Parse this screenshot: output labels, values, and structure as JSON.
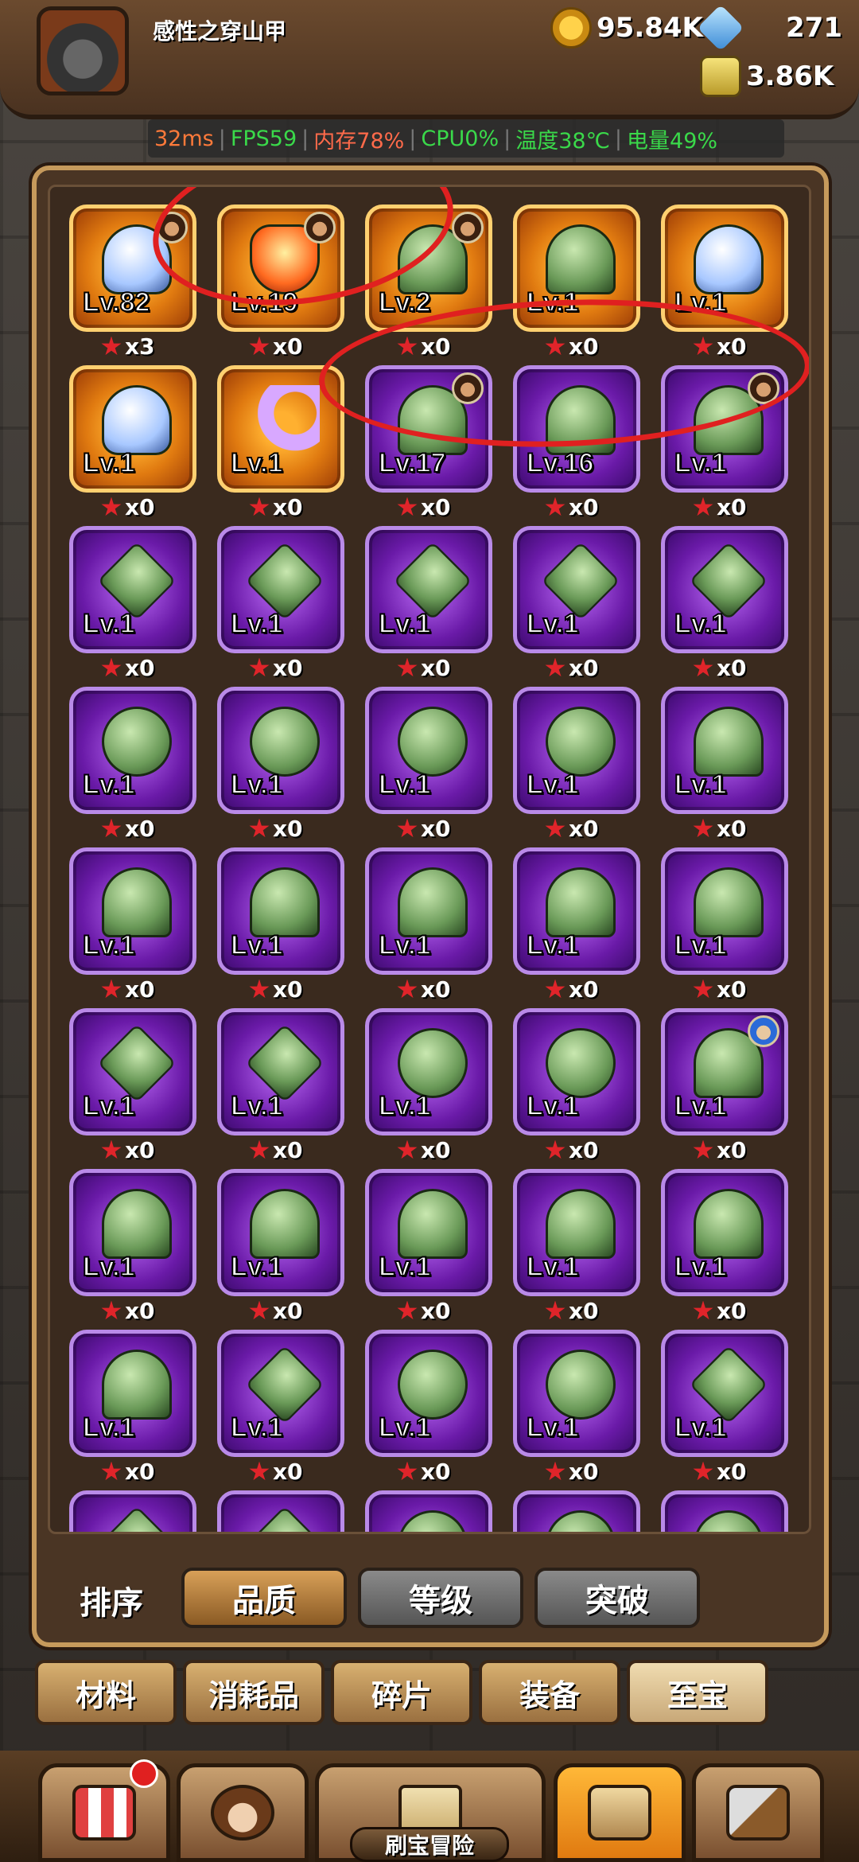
{
  "player": {
    "name": "感性之穿山甲"
  },
  "resources": {
    "gold": "95.84K",
    "gems": "271",
    "essence": "3.86K"
  },
  "perf": {
    "latency": "32ms",
    "fps": "FPS59",
    "memory": "内存78%",
    "cpu": "CPU0%",
    "temperature": "温度38℃",
    "battery": "电量49%"
  },
  "items": [
    {
      "level": "Lv.82",
      "count": "x3",
      "rarity": "orange",
      "emblem": "wing",
      "badge": "dark"
    },
    {
      "level": "Lv.19",
      "count": "x0",
      "rarity": "orange",
      "emblem": "fire",
      "badge": "dark"
    },
    {
      "level": "Lv.2",
      "count": "x0",
      "rarity": "orange",
      "emblem": "e0",
      "badge": "dark"
    },
    {
      "level": "Lv.1",
      "count": "x0",
      "rarity": "orange",
      "emblem": "e0",
      "badge": ""
    },
    {
      "level": "Lv.1",
      "count": "x0",
      "rarity": "orange",
      "emblem": "wing",
      "badge": ""
    },
    {
      "level": "Lv.1",
      "count": "x0",
      "rarity": "orange",
      "emblem": "wing",
      "badge": ""
    },
    {
      "level": "Lv.1",
      "count": "x0",
      "rarity": "orange",
      "emblem": "moon",
      "badge": ""
    },
    {
      "level": "Lv.17",
      "count": "x0",
      "rarity": "purple",
      "emblem": "e0",
      "badge": "dark"
    },
    {
      "level": "Lv.16",
      "count": "x0",
      "rarity": "purple",
      "emblem": "e0",
      "badge": ""
    },
    {
      "level": "Lv.1",
      "count": "x0",
      "rarity": "purple",
      "emblem": "e0",
      "badge": "dark"
    },
    {
      "level": "Lv.1",
      "count": "x0",
      "rarity": "purple",
      "emblem": "e2",
      "badge": ""
    },
    {
      "level": "Lv.1",
      "count": "x0",
      "rarity": "purple",
      "emblem": "e2",
      "badge": ""
    },
    {
      "level": "Lv.1",
      "count": "x0",
      "rarity": "purple",
      "emblem": "e2",
      "badge": ""
    },
    {
      "level": "Lv.1",
      "count": "x0",
      "rarity": "purple",
      "emblem": "e2",
      "badge": ""
    },
    {
      "level": "Lv.1",
      "count": "x0",
      "rarity": "purple",
      "emblem": "e2",
      "badge": ""
    },
    {
      "level": "Lv.1",
      "count": "x0",
      "rarity": "purple",
      "emblem": "e1",
      "badge": ""
    },
    {
      "level": "Lv.1",
      "count": "x0",
      "rarity": "purple",
      "emblem": "e1",
      "badge": ""
    },
    {
      "level": "Lv.1",
      "count": "x0",
      "rarity": "purple",
      "emblem": "e1",
      "badge": ""
    },
    {
      "level": "Lv.1",
      "count": "x0",
      "rarity": "purple",
      "emblem": "e1",
      "badge": ""
    },
    {
      "level": "Lv.1",
      "count": "x0",
      "rarity": "purple",
      "emblem": "e0",
      "badge": ""
    },
    {
      "level": "Lv.1",
      "count": "x0",
      "rarity": "purple",
      "emblem": "e0",
      "badge": ""
    },
    {
      "level": "Lv.1",
      "count": "x0",
      "rarity": "purple",
      "emblem": "e0",
      "badge": ""
    },
    {
      "level": "Lv.1",
      "count": "x0",
      "rarity": "purple",
      "emblem": "e0",
      "badge": ""
    },
    {
      "level": "Lv.1",
      "count": "x0",
      "rarity": "purple",
      "emblem": "e0",
      "badge": ""
    },
    {
      "level": "Lv.1",
      "count": "x0",
      "rarity": "purple",
      "emblem": "e0",
      "badge": ""
    },
    {
      "level": "Lv.1",
      "count": "x0",
      "rarity": "purple",
      "emblem": "e2",
      "badge": ""
    },
    {
      "level": "Lv.1",
      "count": "x0",
      "rarity": "purple",
      "emblem": "e2",
      "badge": ""
    },
    {
      "level": "Lv.1",
      "count": "x0",
      "rarity": "purple",
      "emblem": "e1",
      "badge": ""
    },
    {
      "level": "Lv.1",
      "count": "x0",
      "rarity": "purple",
      "emblem": "e1",
      "badge": ""
    },
    {
      "level": "Lv.1",
      "count": "x0",
      "rarity": "purple",
      "emblem": "e0",
      "badge": "blue"
    },
    {
      "level": "Lv.1",
      "count": "x0",
      "rarity": "purple",
      "emblem": "e0",
      "badge": ""
    },
    {
      "level": "Lv.1",
      "count": "x0",
      "rarity": "purple",
      "emblem": "e0",
      "badge": ""
    },
    {
      "level": "Lv.1",
      "count": "x0",
      "rarity": "purple",
      "emblem": "e0",
      "badge": ""
    },
    {
      "level": "Lv.1",
      "count": "x0",
      "rarity": "purple",
      "emblem": "e0",
      "badge": ""
    },
    {
      "level": "Lv.1",
      "count": "x0",
      "rarity": "purple",
      "emblem": "e0",
      "badge": ""
    },
    {
      "level": "Lv.1",
      "count": "x0",
      "rarity": "purple",
      "emblem": "e0",
      "badge": ""
    },
    {
      "level": "Lv.1",
      "count": "x0",
      "rarity": "purple",
      "emblem": "e2",
      "badge": ""
    },
    {
      "level": "Lv.1",
      "count": "x0",
      "rarity": "purple",
      "emblem": "e1",
      "badge": ""
    },
    {
      "level": "Lv.1",
      "count": "x0",
      "rarity": "purple",
      "emblem": "e1",
      "badge": ""
    },
    {
      "level": "Lv.1",
      "count": "x0",
      "rarity": "purple",
      "emblem": "e2",
      "badge": ""
    },
    {
      "level": "",
      "count": "",
      "rarity": "purple",
      "emblem": "e2",
      "badge": ""
    },
    {
      "level": "",
      "count": "",
      "rarity": "purple",
      "emblem": "e2",
      "badge": ""
    },
    {
      "level": "",
      "count": "",
      "rarity": "purple",
      "emblem": "e1",
      "badge": ""
    },
    {
      "level": "",
      "count": "",
      "rarity": "purple",
      "emblem": "e1",
      "badge": ""
    },
    {
      "level": "",
      "count": "",
      "rarity": "purple",
      "emblem": "e1",
      "badge": ""
    }
  ],
  "sort": {
    "label": "排序",
    "options": [
      "品质",
      "等级",
      "突破"
    ],
    "active": 0
  },
  "tabs": {
    "items": [
      "材料",
      "消耗品",
      "碎片",
      "装备",
      "至宝"
    ],
    "active": 4
  },
  "nav": {
    "adventure_label": "刷宝冒险"
  },
  "colors": {
    "annotation": "#e02020",
    "orange_tile": "#e07a10",
    "purple_tile": "#6a1aa8"
  }
}
